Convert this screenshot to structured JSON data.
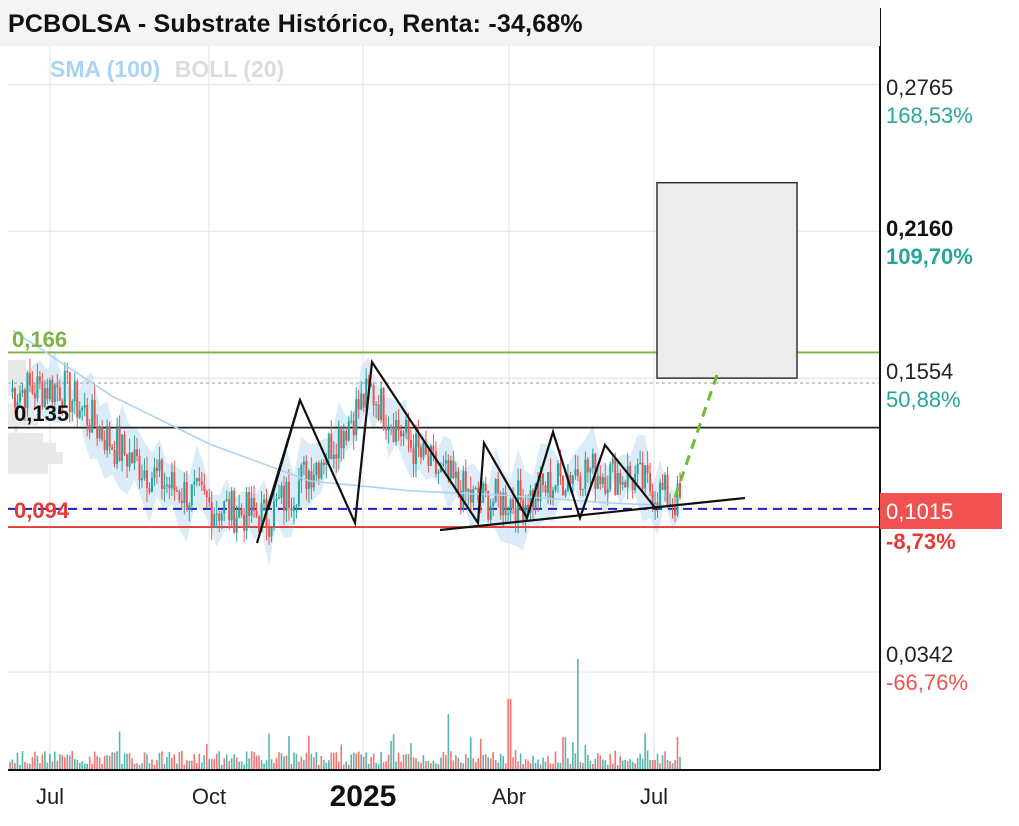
{
  "title": "PCBOLSA - Substrate Histórico, Renta: -34,68%",
  "legend": {
    "sma": "SMA (100)",
    "boll": "BOLL (20)"
  },
  "price_labels": {
    "resistance": "0,166",
    "mid": "0,135",
    "support": "0,094"
  },
  "right_axis": [
    {
      "price": "0,2765",
      "pct": "168,53%"
    },
    {
      "price": "0,2160",
      "pct": "109,70%"
    },
    {
      "price": "0,1554",
      "pct": "50,88%"
    },
    {
      "price": "0,1015",
      "pct": "-8,73%"
    },
    {
      "price": "0,0342",
      "pct": "-66,76%"
    }
  ],
  "x_labels": [
    "Jul",
    "Oct",
    "2025",
    "Abr",
    "Jul"
  ],
  "colors": {
    "up": "#26a69a",
    "down": "#ef5350",
    "green_line": "#7cb342",
    "red_line": "#e53935",
    "blue_dashed": "#1e1ec8",
    "sma": "#a9d4f5",
    "boll_band": "#cfe6f7"
  },
  "chart_data": {
    "type": "line",
    "title": "PCBOLSA - Substrate Histórico, Renta: -34,68%",
    "series": [
      {
        "name": "",
        "x": [
          "2024-06",
          "2024-07",
          "2024-08",
          "2024-09",
          "2024-10",
          "2024-11",
          "2024-12",
          "2025-01",
          "2025-02",
          "2025-03",
          "2025-04",
          "2025-05",
          "2025-06",
          "2025-07"
        ],
        "values": [
          0.15,
          0.152,
          0.128,
          0.112,
          0.102,
          0.098,
          0.122,
          0.15,
          0.122,
          0.105,
          0.105,
          0.118,
          0.115,
          0.104
        ]
      },
      {
        "name": "SMA (100)",
        "x": [
          "2024-06",
          "2024-08",
          "2024-10",
          "2024-12",
          "2025-02",
          "2025-04",
          "2025-06",
          "2025-07"
        ],
        "values": [
          0.175,
          0.148,
          0.128,
          0.113,
          0.109,
          0.107,
          0.104,
          0.103
        ]
      }
    ],
    "levels": {
      "resistance": 0.166,
      "mid": 0.135,
      "support": 0.094,
      "current": 0.1015,
      "target_zone": [
        0.1554,
        0.236
      ]
    },
    "ylim": [
      0.004,
      0.305
    ],
    "right_ticks": [
      0.2765,
      0.216,
      0.1554,
      0.1015,
      0.0342
    ],
    "xlabel": "",
    "ylabel": "",
    "x_tick_labels": [
      "Jul",
      "Oct",
      "2025",
      "Abr",
      "Jul"
    ],
    "grid": true
  }
}
